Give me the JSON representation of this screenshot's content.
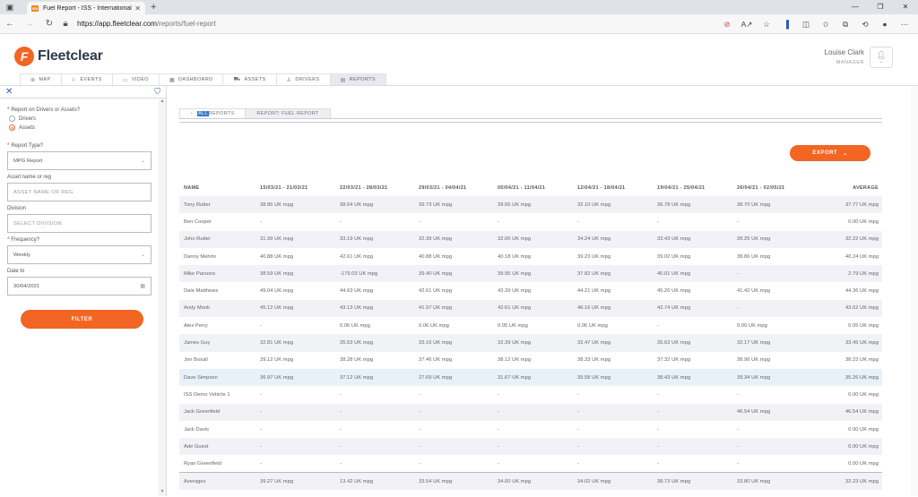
{
  "browser": {
    "tab_title": "Fuel Report - ISS - International",
    "favicon_text": "ISS",
    "url_host": "https://app.fleetclear.com",
    "url_path": "/reports/fuel-report"
  },
  "app": {
    "logo_text": "Fleetclear",
    "user_name": "Louise Clark",
    "user_role": "MANAGER"
  },
  "nav": [
    "MAP",
    "EVENTS",
    "VIDEO",
    "DASHBOARD",
    "ASSETS",
    "DRIVERS",
    "REPORTS"
  ],
  "sidebar": {
    "report_on_label": "Report on Drivers or Assets?",
    "option_drivers": "Drivers",
    "option_assets": "Assets",
    "report_type_label": "Report Type?",
    "report_type_value": "MPG Report",
    "asset_label": "Asset name or reg",
    "asset_placeholder": "ASSET NAME OR REG",
    "division_label": "Division",
    "division_placeholder": "SELECT DIVISION",
    "frequency_label": "Frequency?",
    "frequency_value": "Weekly",
    "date_label": "Date to",
    "date_value": "30/04/2021",
    "filter_label": "FILTER"
  },
  "breadcrumbs": {
    "all_prefix": "ALL",
    "all_suffix": " REPORTS",
    "current": "REPORT: FUEL REPORT"
  },
  "export_label": "EXPORT",
  "table": {
    "headers": [
      "NAME",
      "15/03/21 - 21/03/21",
      "22/03/21 - 28/03/21",
      "29/03/21 - 04/04/21",
      "05/04/21 - 11/04/21",
      "12/04/21 - 18/04/21",
      "19/04/21 - 25/04/21",
      "26/04/21 - 02/05/21",
      "AVERAGE"
    ],
    "rows": [
      [
        "Tony Rutter",
        "38.86 UK mpg",
        "38.64 UK mpg",
        "39.73 UK mpg",
        "39.56 UK mpg",
        "32.10 UK mpg",
        "36.78 UK mpg",
        "38.70 UK mpg",
        "37.77 UK mpg"
      ],
      [
        "Ben Cooper",
        "-",
        "-",
        "-",
        "-",
        "-",
        "-",
        "-",
        "0.00 UK mpg"
      ],
      [
        "John Rutter",
        "31.99 UK mpg",
        "33.19 UK mpg",
        "32.39 UK mpg",
        "32.06 UK mpg",
        "34.24 UK mpg",
        "33.43 UK mpg",
        "28.25 UK mpg",
        "32.22 UK mpg"
      ],
      [
        "Danny Mehmi",
        "40.88 UK mpg",
        "42.61 UK mpg",
        "40.88 UK mpg",
        "40.18 UK mpg",
        "39.23 UK mpg",
        "39.02 UK mpg",
        "38.86 UK mpg",
        "40.24 UK mpg"
      ],
      [
        "Mike Parsons",
        "38.59 UK mpg",
        "-179.03 UK mpg",
        "39.40 UK mpg",
        "39.95 UK mpg",
        "37.82 UK mpg",
        "40.01 UK mpg",
        "-",
        "2.79 UK mpg"
      ],
      [
        "Dale Matthews",
        "49.04 UK mpg",
        "44.63 UK mpg",
        "42.61 UK mpg",
        "43.39 UK mpg",
        "44.21 UK mpg",
        "45.20 UK mpg",
        "41.42 UK mpg",
        "44.36 UK mpg"
      ],
      [
        "Andy Monk",
        "45.12 UK mpg",
        "43.13 UK mpg",
        "41.97 UK mpg",
        "42.61 UK mpg",
        "46.16 UK mpg",
        "42.74 UK mpg",
        "-",
        "43.62 UK mpg"
      ],
      [
        "Alex Perry",
        "-",
        "0.06 UK mpg",
        "0.06 UK mpg",
        "0.05 UK mpg",
        "0.06 UK mpg",
        "-",
        "0.00 UK mpg",
        "0.05 UK mpg"
      ],
      [
        "James Guy",
        "32.81 UK mpg",
        "35.53 UK mpg",
        "33.16 UK mpg",
        "32.39 UK mpg",
        "32.47 UK mpg",
        "35.62 UK mpg",
        "32.17 UK mpg",
        "33.45 UK mpg"
      ],
      [
        "Jon Boxall",
        "39.12 UK mpg",
        "38.28 UK mpg",
        "37.46 UK mpg",
        "38.12 UK mpg",
        "38.33 UK mpg",
        "37.32 UK mpg",
        "38.96 UK mpg",
        "38.23 UK mpg"
      ],
      [
        "Dave Simpson",
        "36.97 UK mpg",
        "37.12 UK mpg",
        "27.69 UK mpg",
        "31.67 UK mpg",
        "35.58 UK mpg",
        "38.43 UK mpg",
        "39.34 UK mpg",
        "35.26 UK mpg"
      ],
      [
        "ISS Demo Vehicle 1",
        "-",
        "-",
        "-",
        "-",
        "-",
        "-",
        "-",
        "0.00 UK mpg"
      ],
      [
        "Jack Greenfield",
        "-",
        "-",
        "-",
        "-",
        "-",
        "-",
        "46.54 UK mpg",
        "46.54 UK mpg"
      ],
      [
        "Jack Davis",
        "-",
        "-",
        "-",
        "-",
        "-",
        "-",
        "-",
        "0.00 UK mpg"
      ],
      [
        "Ade Guest",
        "-",
        "-",
        "-",
        "-",
        "-",
        "-",
        "-",
        "0.00 UK mpg"
      ],
      [
        "Ryan Greenfield",
        "-",
        "-",
        "-",
        "-",
        "-",
        "-",
        "-",
        "0.00 UK mpg"
      ]
    ],
    "averages": [
      "Averages",
      "39.27 UK mpg",
      "13.42 UK mpg",
      "33.54 UK mpg",
      "34.00 UK mpg",
      "34.02 UK mpg",
      "38.73 UK mpg",
      "33.80 UK mpg",
      "32.23 UK mpg"
    ]
  },
  "colors": {
    "accent": "#f26522",
    "stripe": "#f0f2f6",
    "highlight": "#e7f1fa"
  }
}
